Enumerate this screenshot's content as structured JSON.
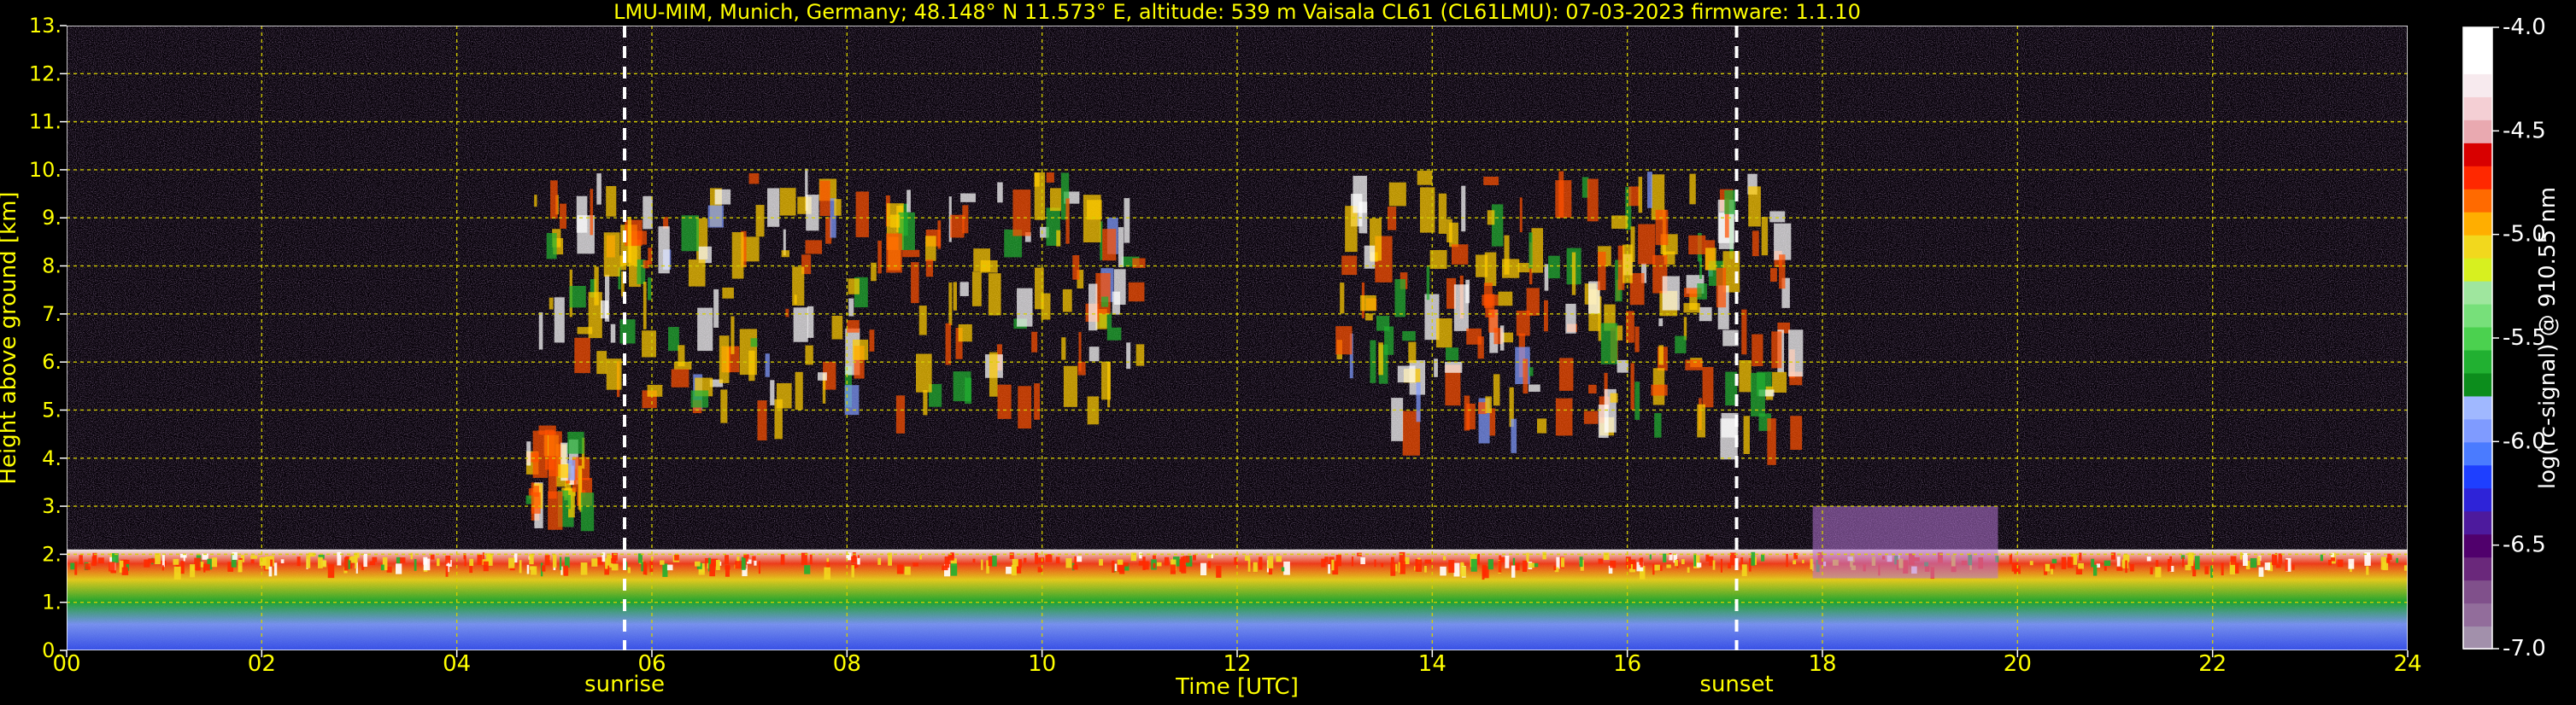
{
  "chart_data": {
    "type": "heatmap",
    "title": "LMU-MIM, Munich, Germany; 48.148° N 11.573° E, altitude: 539 m    Vaisala CL61 (CL61LMU): 07-03-2023    firmware: 1.1.10",
    "xlabel": "Time [UTC]",
    "ylabel": "Height above ground [km]",
    "xlim": [
      0,
      24
    ],
    "ylim": [
      0,
      13
    ],
    "x_ticks": [
      "00",
      "02",
      "04",
      "06",
      "08",
      "10",
      "12",
      "14",
      "16",
      "18",
      "20",
      "22",
      "24"
    ],
    "y_ticks": [
      "0.",
      "1.",
      "2.",
      "3.",
      "4.",
      "5.",
      "6.",
      "7.",
      "8.",
      "9.",
      "10.",
      "11.",
      "12.",
      "13."
    ],
    "grid": true,
    "markers": [
      {
        "label": "sunrise",
        "x": 5.72
      },
      {
        "label": "sunset",
        "x": 17.12
      }
    ],
    "colorbar": {
      "label": "log(rc-signal) @ 910.55 nm",
      "range": [
        -7.0,
        -4.0
      ],
      "ticks": [
        "-4.0",
        "-4.5",
        "-5.0",
        "-5.5",
        "-6.0",
        "-6.5",
        "-7.0"
      ],
      "colors_low_to_high": [
        "#a290ab",
        "#926d9b",
        "#80508b",
        "#6a287b",
        "#50006c",
        "#4d1a9d",
        "#2e23d8",
        "#1e3fff",
        "#4a7bff",
        "#7f9bff",
        "#a0b8ff",
        "#0c8d1c",
        "#21b031",
        "#4bd14f",
        "#77e07a",
        "#9fe69e",
        "#d7f01f",
        "#f2d81d",
        "#ffae00",
        "#ff6a00",
        "#ff2800",
        "#d80000",
        "#e9a9b0",
        "#f4cfd4",
        "#f7eaee",
        "#ffffff",
        "#ffffff"
      ]
    },
    "features": [
      {
        "name": "boundary-layer",
        "x_start": 0,
        "x_end": 24,
        "height_km": [
          0,
          2.1
        ]
      },
      {
        "name": "high-cloud-morning",
        "x_start": 4.7,
        "x_end": 11.0,
        "height_km": [
          5.2,
          10.1
        ]
      },
      {
        "name": "low-cloud-early",
        "x_start": 4.7,
        "x_end": 5.3,
        "height_km": [
          3.2,
          4.8
        ]
      },
      {
        "name": "high-cloud-afternoon",
        "x_start": 13.0,
        "x_end": 17.7,
        "height_km": [
          4.8,
          10.0
        ]
      },
      {
        "name": "evening-layer",
        "x_start": 17.9,
        "x_end": 19.8,
        "height_km": [
          1.5,
          3.0
        ]
      }
    ]
  }
}
